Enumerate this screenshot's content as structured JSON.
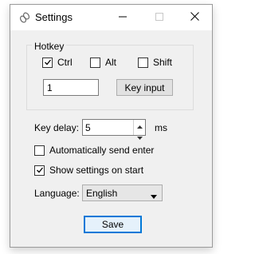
{
  "window": {
    "title": "Settings"
  },
  "hotkey": {
    "group_label": "Hotkey",
    "ctrl_label": "Ctrl",
    "ctrl_checked": true,
    "alt_label": "Alt",
    "alt_checked": false,
    "shift_label": "Shift",
    "shift_checked": false,
    "key_value": "1",
    "key_input_button": "Key input"
  },
  "settings": {
    "key_delay_label": "Key delay:",
    "key_delay_value": "5",
    "key_delay_unit": "ms",
    "auto_enter_label": "Automatically send enter",
    "auto_enter_checked": false,
    "show_on_start_label": "Show settings on start",
    "show_on_start_checked": true,
    "language_label": "Language:",
    "language_value": "English"
  },
  "footer": {
    "save_label": "Save"
  },
  "icons": {
    "app": "link-icon",
    "minimize": "minimize-icon",
    "maximize": "maximize-icon",
    "close": "close-icon",
    "check": "checkmark-icon",
    "spin_up": "spin-up-icon",
    "spin_down": "spin-down-icon",
    "dropdown": "chevron-down-icon"
  }
}
